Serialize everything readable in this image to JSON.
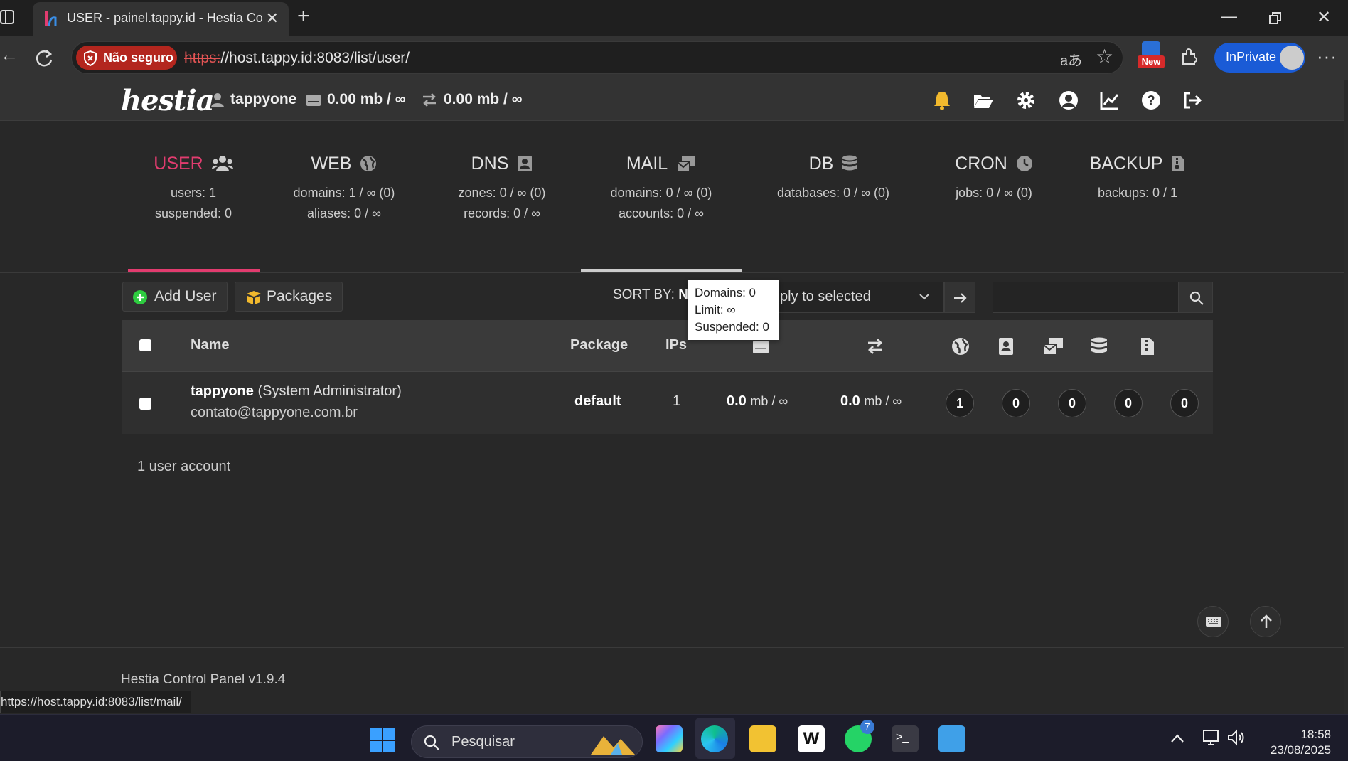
{
  "browser": {
    "tab_title": "USER - painel.tappy.id - Hestia Co",
    "security_label": "Não seguro",
    "url_scheme": "https:",
    "url_rest": "//host.tappy.id:8083/list/user/",
    "new_badge": "New",
    "inprivate_label": "InPrivate"
  },
  "header": {
    "username": "tappyone",
    "disk_usage": "0.00 mb / ∞",
    "bandwidth_usage": "0.00 mb / ∞"
  },
  "stats": [
    {
      "title": "USER",
      "line1": "users: 1",
      "line2": "suspended: 0"
    },
    {
      "title": "WEB",
      "line1": "domains: 1 / ∞ (0)",
      "line2": "aliases: 0 / ∞"
    },
    {
      "title": "DNS",
      "line1": "zones: 0 / ∞ (0)",
      "line2": "records: 0 / ∞"
    },
    {
      "title": "MAIL",
      "line1": "domains: 0 / ∞ (0)",
      "line2": "accounts: 0 / ∞"
    },
    {
      "title": "DB",
      "line1": "databases: 0 / ∞ (0)",
      "line2": ""
    },
    {
      "title": "CRON",
      "line1": "jobs: 0 / ∞ (0)",
      "line2": ""
    },
    {
      "title": "BACKUP",
      "line1": "backups: 0 / 1",
      "line2": ""
    }
  ],
  "toolbar": {
    "add_user": "Add User",
    "packages": "Packages",
    "sort_by_label": "SORT BY:",
    "sort_by_value": "N",
    "apply_select": "ply to selected"
  },
  "tooltip": {
    "line1": "Domains: 0",
    "line2": "Limit: ∞",
    "line3": "Suspended: 0"
  },
  "table": {
    "headers": {
      "name": "Name",
      "package": "Package",
      "ips": "IPs"
    },
    "row": {
      "username": "tappyone",
      "role": "(System Administrator)",
      "email": "contato@tappyone.com.br",
      "package": "default",
      "ips": "1",
      "disk_value": "0.0",
      "disk_unit": "mb / ∞",
      "bw_value": "0.0",
      "bw_unit": "mb / ∞",
      "web": "1",
      "dns": "0",
      "mail": "0",
      "db": "0",
      "backup": "0"
    }
  },
  "account_count": "1 user account",
  "footer": "Hestia Control Panel v1.9.4",
  "status_url": "https://host.tappy.id:8083/list/mail/",
  "taskbar": {
    "search_placeholder": "Pesquisar",
    "whatsapp_badge": "7",
    "time": "18:58",
    "date": "23/08/2025"
  },
  "colors": {
    "accent": "#e23c6f",
    "background": "#282828",
    "insecure": "#b3261e",
    "inprivate": "#1a5bd6"
  }
}
